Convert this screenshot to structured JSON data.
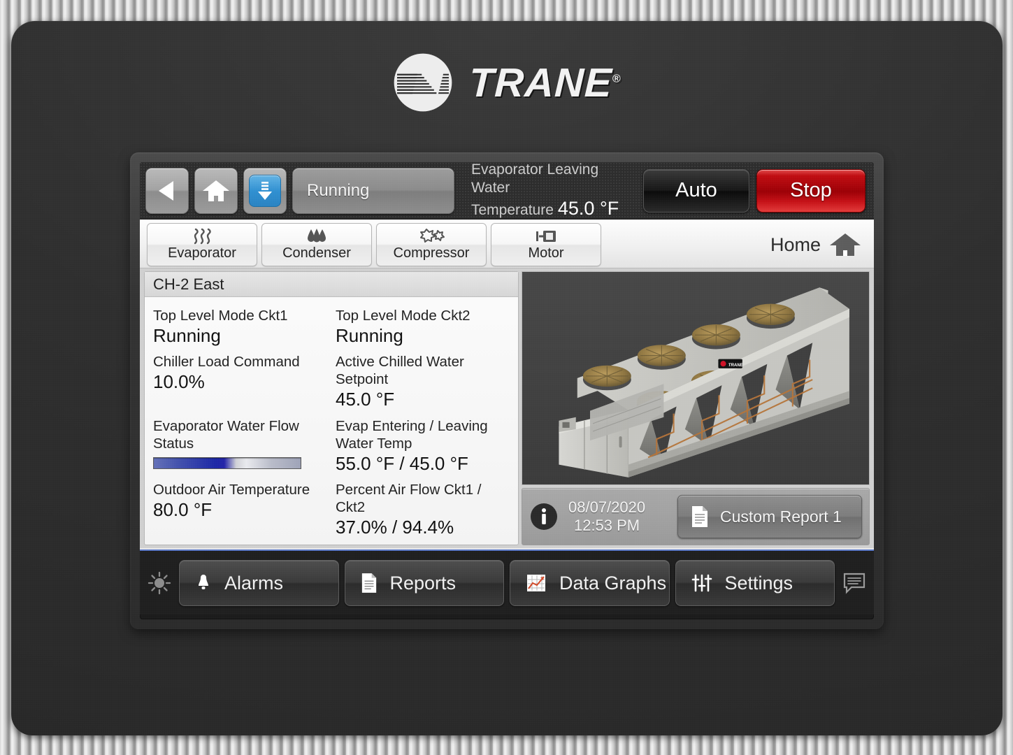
{
  "brand": {
    "name": "TRANE",
    "registered": "®"
  },
  "topbar": {
    "back_icon": "back-arrow-icon",
    "home_icon": "home-icon",
    "download_icon": "download-icon",
    "status_text": "Running",
    "readout_label_line1": "Evaporator Leaving Water",
    "readout_label_line2": "Temperature",
    "readout_value": "45.0 °F",
    "auto_label": "Auto",
    "stop_label": "Stop",
    "colors": {
      "stop_red": "#c00d12",
      "accent_blue": "#2f8fd0"
    }
  },
  "tabs": [
    {
      "label": "Evaporator",
      "icon": "steam-waves-icon"
    },
    {
      "label": "Condenser",
      "icon": "water-droplets-icon"
    },
    {
      "label": "Compressor",
      "icon": "compressor-burst-icon"
    },
    {
      "label": "Motor",
      "icon": "motor-icon"
    }
  ],
  "home_link": {
    "label": "Home",
    "icon": "home-icon"
  },
  "panel": {
    "title": "CH-2 East",
    "fields": [
      {
        "key": "Top Level Mode Ckt1",
        "value": "Running"
      },
      {
        "key": "Top Level Mode Ckt2",
        "value": "Running"
      },
      {
        "key": "Chiller Load Command",
        "value": "10.0%"
      },
      {
        "key": "Active Chilled Water Setpoint",
        "value": "45.0 °F"
      },
      {
        "key": "Evaporator Water Flow Status",
        "value": ""
      },
      {
        "key": "Evap Entering / Leaving Water Temp",
        "value": "55.0 °F / 45.0 °F"
      },
      {
        "key": "Outdoor Air Temperature",
        "value": "80.0 °F"
      },
      {
        "key": "Percent Air Flow Ckt1 / Ckt2",
        "value": "37.0% / 94.4%"
      }
    ],
    "flow_bar": {
      "name": "evaporator-flow-indicator",
      "colors": [
        "#4453ad",
        "#1d28a6",
        "#e9eaee",
        "#9ea3b8"
      ]
    }
  },
  "photo": {
    "alt": "air-cooled-chiller-render",
    "unit_logo": "TRANE"
  },
  "infobar": {
    "info_icon": "info-icon",
    "date": "08/07/2020",
    "time": "12:53 PM",
    "report_label": "Custom Report 1",
    "report_icon": "document-icon"
  },
  "navbar": {
    "brightness_icon": "brightness-icon",
    "chat_icon": "chat-bubble-icon",
    "items": [
      {
        "label": "Alarms",
        "icon": "bell-icon"
      },
      {
        "label": "Reports",
        "icon": "document-icon"
      },
      {
        "label": "Data Graphs",
        "icon": "chart-icon"
      },
      {
        "label": "Settings",
        "icon": "sliders-icon"
      }
    ]
  }
}
